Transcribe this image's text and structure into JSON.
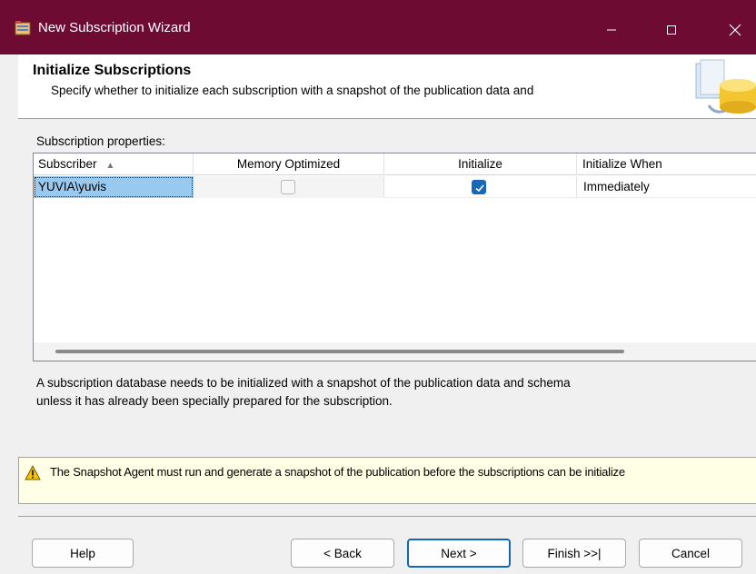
{
  "window": {
    "title": "New Subscription Wizard",
    "controls": {
      "minimize": "minimize-icon",
      "maximize": "maximize-icon",
      "close": "close-icon"
    }
  },
  "header": {
    "title": "Initialize Subscriptions",
    "subtitle": "Specify whether to initialize each subscription with a snapshot of the publication data and"
  },
  "properties_label": "Subscription properties:",
  "grid": {
    "columns": [
      "Subscriber",
      "Memory Optimized",
      "Initialize",
      "Initialize When"
    ],
    "sort_indicator": "▲",
    "rows": [
      {
        "subscriber": "YUVIA\\yuvis",
        "memory_optimized": false,
        "initialize": true,
        "initialize_when": "Immediately"
      }
    ]
  },
  "description": {
    "line1": "A subscription database needs to be initialized with a snapshot of the publication data and schema",
    "line2": "unless it has already been specially prepared for the subscription."
  },
  "warning": {
    "icon": "warning-icon",
    "text": "The Snapshot Agent must run and generate a snapshot of the publication before the subscriptions can be initialize"
  },
  "buttons": {
    "help": "Help",
    "back": "< Back",
    "next": "Next >",
    "finish": "Finish >>|",
    "cancel": "Cancel"
  },
  "colors": {
    "titlebar": "#6e0b32",
    "selection": "#99c9ef",
    "checkbox_checked": "#1a67b8",
    "warning_background": "#ffffe6",
    "default_button_border": "#1466b8"
  }
}
